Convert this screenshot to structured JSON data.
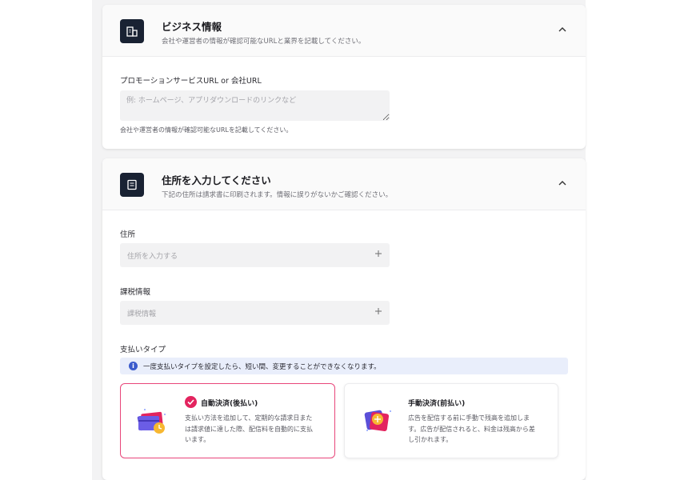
{
  "business": {
    "title": "ビジネス情報",
    "subtitle": "会社や運営者の情報が確認可能なURLと業界を記載してください。",
    "url_label": "プロモーションサービスURL or 会社URL",
    "url_placeholder": "例: ホームページ、アプリダウンロードのリンクなど",
    "helper": "会社や運営者の情報が確認可能なURLを記載してください。",
    "icon": "building-icon"
  },
  "address": {
    "title": "住所を入力してください",
    "subtitle": "下記の住所は請求書に印刷されます。情報に誤りがないかご確認ください。",
    "icon": "receipt-icon",
    "address_label": "住所",
    "address_placeholder": "住所を入力する",
    "tax_label": "課税情報",
    "tax_placeholder": "課税情報",
    "payment_type_label": "支払いタイプ",
    "info_text": "一度支払いタイプを設定したら、短い間、変更することができなくなります。",
    "options": [
      {
        "title": "自動決済(後払い)",
        "description": [
          "支払い方法を追加して、定期的な請求日また",
          "は請求値に達した際、配信料を自動的に支払",
          "います。"
        ],
        "selected": true
      },
      {
        "title": "手動決済(前払い)",
        "description": [
          "広告を配信する前に手動で残高を追加しま",
          "す。広告が配信されると、料金は残高から差",
          "し引かれます。"
        ],
        "selected": false
      }
    ]
  },
  "colors": {
    "accent": "#e3245f",
    "icon_bg": "#192233",
    "info_bg": "#e9eefb",
    "info_icon": "#3b5bcc"
  }
}
